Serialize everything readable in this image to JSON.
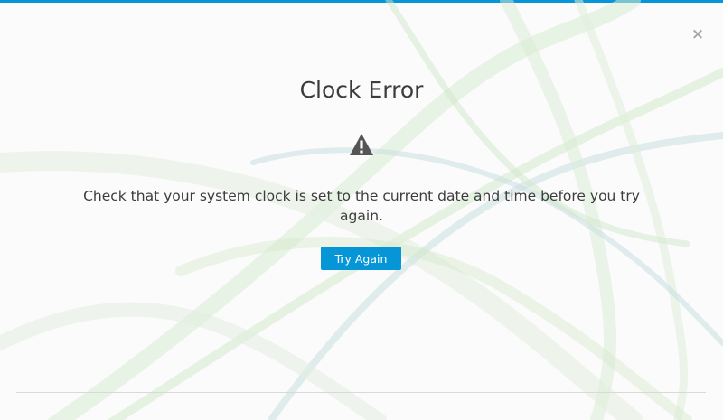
{
  "colors": {
    "accent": "#0696d7",
    "button_bg": "#0696d7",
    "text": "#3c3c3c",
    "icon": "#555555",
    "close": "#a8a8a8"
  },
  "dialog": {
    "title": "Clock Error",
    "icon": "warning-icon",
    "message": "Check that your system clock is set to the current date and time before you try again.",
    "button_label": "Try Again",
    "close_icon": "×"
  }
}
